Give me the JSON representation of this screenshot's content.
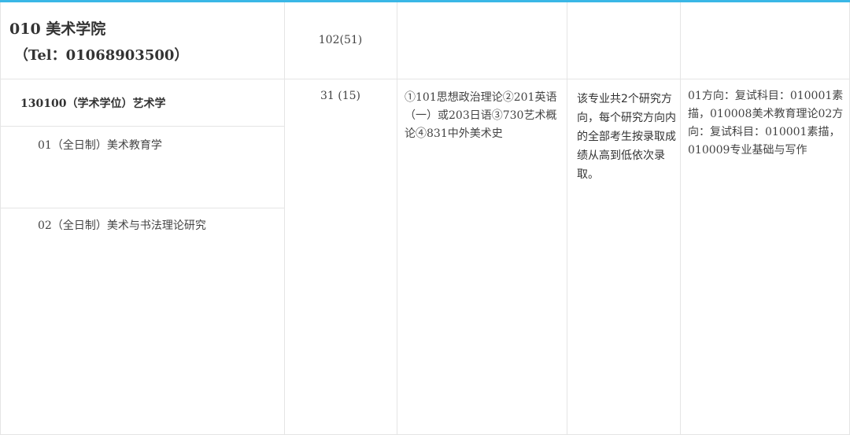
{
  "college": {
    "name": "010 美术学院",
    "tel": "（Tel：01068903500）",
    "total": "102(51)"
  },
  "major": {
    "name": "130100（学术学位）艺术学",
    "count": "31 (15)",
    "exam_subjects": "①101思想政治理论②201英语（一）或203日语③730艺术概论④831中外美术史",
    "note": "该专业共2个研究方向，每个研究方向内的全部考生按录取成绩从高到低依次录取。",
    "retest": "01方向：复试科目：010001素描，010008美术教育理论02方向：复试科目：010001素描，010009专业基础与写作",
    "directions": [
      {
        "label": "01（全日制）美术教育学"
      },
      {
        "label": "02（全日制）美术与书法理论研究"
      }
    ]
  },
  "colors": {
    "accent": "#3ab7e6",
    "grid": "#e5e5e5",
    "text": "#333333"
  }
}
